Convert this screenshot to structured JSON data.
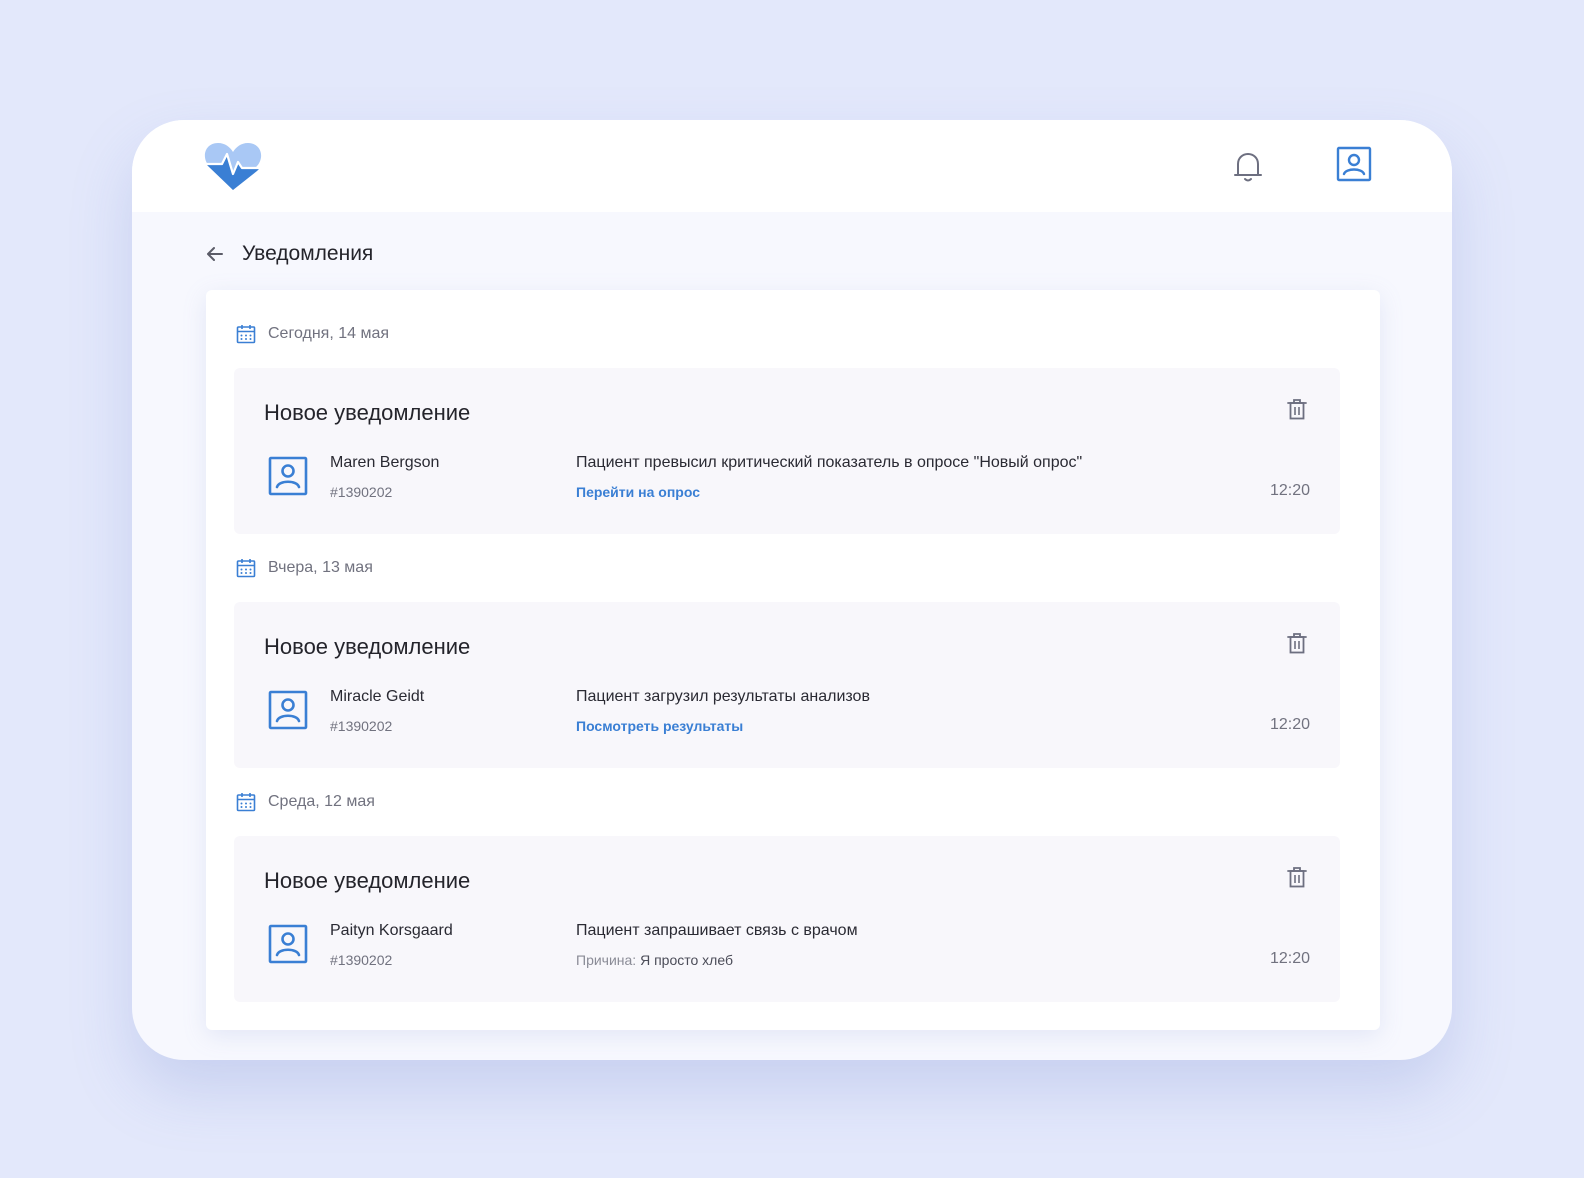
{
  "header": {
    "logo_icon": "heart-pulse-logo",
    "bell_icon": "bell-icon",
    "profile_icon": "profile-icon"
  },
  "page": {
    "title": "Уведомления",
    "back_icon": "arrow-left-icon"
  },
  "colors": {
    "background": "#e3e8fb",
    "accent": "#3a7fd4",
    "logo_light": "#a9c8f5",
    "logo_dark": "#3a7fd4"
  },
  "groups": [
    {
      "date_label": "Сегодня, 14 мая",
      "notification": {
        "title": "Новое уведомление",
        "patient_name": "Maren Bergson",
        "patient_id": "#1390202",
        "message": "Пациент превысил критический показатель в опросе \"Новый опрос\"",
        "link": "Перейти на опрос",
        "time": "12:20"
      }
    },
    {
      "date_label": "Вчера, 13 мая",
      "notification": {
        "title": "Новое уведомление",
        "patient_name": "Miracle Geidt",
        "patient_id": "#1390202",
        "message": "Пациент загрузил результаты анализов",
        "link": "Посмотреть результаты",
        "time": "12:20"
      }
    },
    {
      "date_label": "Среда, 12 мая",
      "notification": {
        "title": "Новое уведомление",
        "patient_name": "Paityn Korsgaard",
        "patient_id": "#1390202",
        "message": "Пациент запрашивает связь с врачом",
        "reason_label": "Причина:",
        "reason_value": "Я просто хлеб",
        "time": "12:20"
      }
    }
  ]
}
